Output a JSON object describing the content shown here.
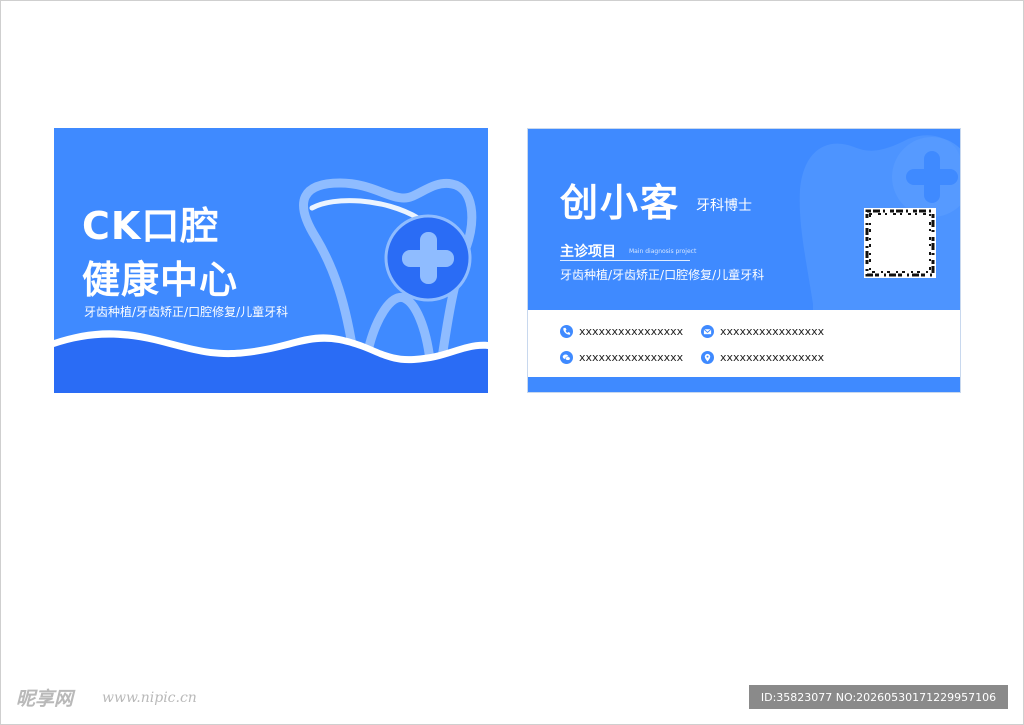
{
  "front": {
    "title_line1": "CK口腔",
    "title_line2": "健康中心",
    "services": "牙齿种植/牙齿矫正/口腔修复/儿童牙科",
    "icons": [
      "tooth-outline-icon",
      "plus-circle-icon"
    ]
  },
  "back": {
    "name": "创小客",
    "title": "牙科博士",
    "main_heading": "主诊项目",
    "main_heading_en": "Main diagnosis project",
    "main_list": "牙齿种植/牙齿矫正/口腔修复/儿童牙科",
    "contacts": [
      {
        "icon": "phone-icon",
        "text": "xxxxxxxxxxxxxxxx"
      },
      {
        "icon": "mail-icon",
        "text": "xxxxxxxxxxxxxxxx"
      },
      {
        "icon": "wechat-icon",
        "text": "xxxxxxxxxxxxxxxx"
      },
      {
        "icon": "location-icon",
        "text": "xxxxxxxxxxxxxxxx"
      }
    ]
  },
  "footer": {
    "site_logo": "昵享网",
    "site_url": "www.nipic.cn",
    "id_text": "ID:35823077 NO:20260530171229957106"
  },
  "colors": {
    "card_blue": "#3f8aff",
    "wave_blue": "#2a6cf5",
    "light_blue": "#8fbcff"
  }
}
